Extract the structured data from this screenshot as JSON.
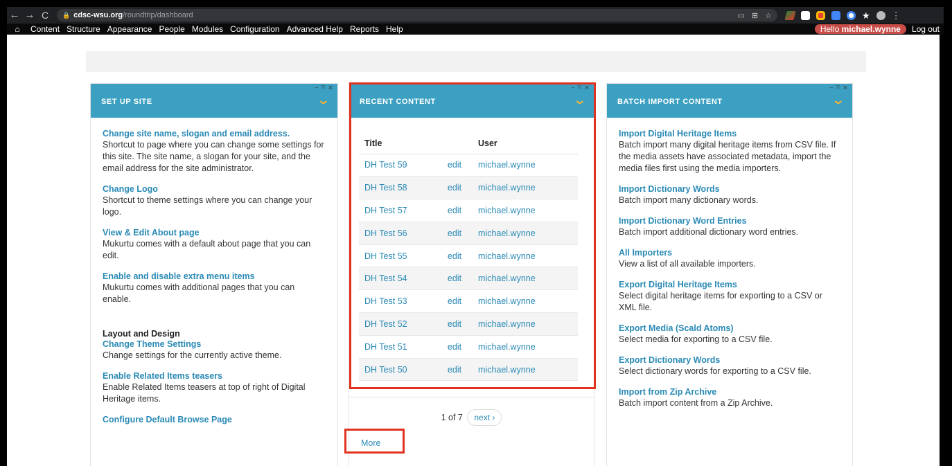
{
  "browser": {
    "url_domain": "cdsc-wsu.org",
    "url_path": "/roundtrip/dashboard"
  },
  "toolbar": {
    "items": [
      "Content",
      "Structure",
      "Appearance",
      "People",
      "Modules",
      "Configuration",
      "Advanced Help",
      "Reports",
      "Help"
    ],
    "hello_prefix": "Hello ",
    "username": "michael.wynne",
    "logout": "Log out"
  },
  "setup_site": {
    "title": "SET UP SITE",
    "entries": [
      {
        "link": "Change site name, slogan and email address.",
        "desc": "Shortcut to page where you can change some settings for this site. The site name, a slogan for your site, and the email address for the site administrator."
      },
      {
        "link": "Change Logo",
        "desc": "Shortcut to theme settings where you can change your logo."
      },
      {
        "link": "View & Edit About page",
        "desc": "Mukurtu comes with a default about page that you can edit."
      },
      {
        "link": "Enable and disable extra menu items",
        "desc": "Mukurtu comes with additional pages that you can enable."
      }
    ],
    "layout_heading": "Layout and Design",
    "layout_entries": [
      {
        "link": "Change Theme Settings",
        "desc": "Change settings for the currently active theme."
      },
      {
        "link": "Enable Related Items teasers",
        "desc": "Enable Related Items teasers at top of right of Digital Heritage items."
      },
      {
        "link": "Configure Default Browse Page",
        "desc": ""
      }
    ]
  },
  "recent_content": {
    "title": "RECENT CONTENT",
    "col_title": "Title",
    "col_user": "User",
    "rows": [
      {
        "title": "DH Test 59",
        "edit": "edit",
        "user": "michael.wynne"
      },
      {
        "title": "DH Test 58",
        "edit": "edit",
        "user": "michael.wynne"
      },
      {
        "title": "DH Test 57",
        "edit": "edit",
        "user": "michael.wynne"
      },
      {
        "title": "DH Test 56",
        "edit": "edit",
        "user": "michael.wynne"
      },
      {
        "title": "DH Test 55",
        "edit": "edit",
        "user": "michael.wynne"
      },
      {
        "title": "DH Test 54",
        "edit": "edit",
        "user": "michael.wynne"
      },
      {
        "title": "DH Test 53",
        "edit": "edit",
        "user": "michael.wynne"
      },
      {
        "title": "DH Test 52",
        "edit": "edit",
        "user": "michael.wynne"
      },
      {
        "title": "DH Test 51",
        "edit": "edit",
        "user": "michael.wynne"
      },
      {
        "title": "DH Test 50",
        "edit": "edit",
        "user": "michael.wynne"
      }
    ],
    "pager_text": "1 of 7",
    "pager_next": "next ›",
    "more": "More"
  },
  "batch_import": {
    "title": "BATCH IMPORT CONTENT",
    "entries": [
      {
        "link": "Import Digital Heritage Items",
        "desc": "Batch import many digital heritage items from CSV file. If the media assets have associated metadata, import the media files first using the media importers."
      },
      {
        "link": "Import Dictionary Words",
        "desc": "Batch import many dictionary words."
      },
      {
        "link": "Import Dictionary Word Entries",
        "desc": "Batch import additional dictionary word entries."
      },
      {
        "link": "All Importers",
        "desc": "View a list of all available importers."
      },
      {
        "link": "Export Digital Heritage Items",
        "desc": "Select digital heritage items for exporting to a CSV or XML file."
      },
      {
        "link": "Export Media (Scald Atoms)",
        "desc": "Select media for exporting to a CSV file."
      },
      {
        "link": "Export Dictionary Words",
        "desc": "Select dictionary words for exporting to a CSV file."
      },
      {
        "link": "Import from Zip Archive",
        "desc": "Batch import content from a Zip Archive."
      }
    ]
  },
  "colors": {
    "block_header": "#3ba0c2",
    "link": "#2a8ab5",
    "highlight": "#e0321f",
    "hello_badge": "#c84d48"
  }
}
